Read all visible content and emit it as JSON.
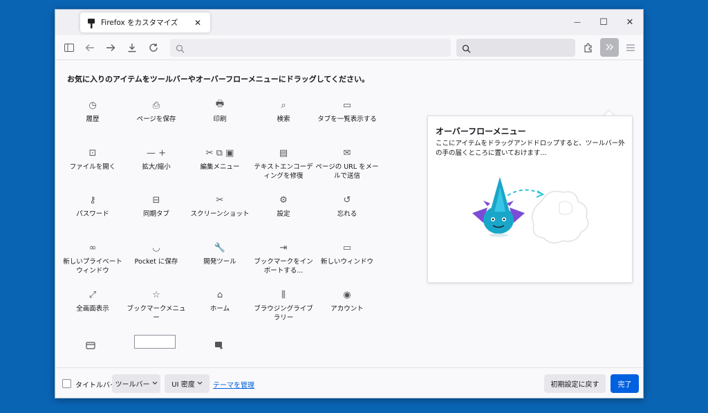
{
  "tab": {
    "title": "Firefox をカスタマイズ",
    "close": "✕"
  },
  "window_controls": {
    "minimize": "—",
    "maximize": "☐",
    "close": "✕"
  },
  "instructions": "お気に入りのアイテムをツールバーやオーバーフローメニューにドラッグしてください。",
  "palette": [
    {
      "label": "履歴",
      "icon": "clock-icon",
      "glyph": "◷"
    },
    {
      "label": "ページを保存",
      "icon": "save-page-icon",
      "glyph": "⎙"
    },
    {
      "label": "印刷",
      "icon": "print-icon",
      "glyph": "🖶"
    },
    {
      "label": "検索",
      "icon": "search-icon",
      "glyph": "⌕"
    },
    {
      "label": "タブを一覧表示する",
      "icon": "tab-list-icon",
      "glyph": "▭"
    },
    {
      "label": "ファイルを開く",
      "icon": "open-file-icon",
      "glyph": "⊡"
    },
    {
      "label": "拡大/縮小",
      "icon": "zoom-icon",
      "glyph": "— +"
    },
    {
      "label": "編集メニュー",
      "icon": "edit-menu-icon",
      "glyph": "✂ ⧉ ▣"
    },
    {
      "label": "テキストエンコーディングを修復",
      "icon": "text-encoding-icon",
      "glyph": "▤"
    },
    {
      "label": "ページの URL をメールで送信",
      "icon": "mail-icon",
      "glyph": "✉"
    },
    {
      "label": "パスワード",
      "icon": "key-icon",
      "glyph": "⚷"
    },
    {
      "label": "同期タブ",
      "icon": "synced-tabs-icon",
      "glyph": "⊟"
    },
    {
      "label": "スクリーンショット",
      "icon": "screenshot-icon",
      "glyph": "✂"
    },
    {
      "label": "設定",
      "icon": "gear-icon",
      "glyph": "⚙"
    },
    {
      "label": "忘れる",
      "icon": "forget-icon",
      "glyph": "↺"
    },
    {
      "label": "新しいプライベートウィンドウ",
      "icon": "private-mask-icon",
      "glyph": "∞"
    },
    {
      "label": "Pocket に保存",
      "icon": "pocket-icon",
      "glyph": "◡"
    },
    {
      "label": "開発ツール",
      "icon": "wrench-icon",
      "glyph": "🔧"
    },
    {
      "label": "ブックマークをインポートする...",
      "icon": "import-icon",
      "glyph": "⇥"
    },
    {
      "label": "新しいウィンドウ",
      "icon": "new-window-icon",
      "glyph": "▭"
    },
    {
      "label": "全画面表示",
      "icon": "fullscreen-icon",
      "glyph": "⤢"
    },
    {
      "label": "ブックマークメニュー",
      "icon": "bookmark-menu-icon",
      "glyph": "☆"
    },
    {
      "label": "ホーム",
      "icon": "home-icon",
      "glyph": "⌂"
    },
    {
      "label": "ブラウジングライブラリー",
      "icon": "library-icon",
      "glyph": "⫼"
    },
    {
      "label": "アカウント",
      "icon": "account-icon",
      "glyph": "◉"
    }
  ],
  "panel": {
    "title": "オーバーフローメニュー",
    "description": "ここにアイテムをドラッグアンドドロップすると、ツールバー外の手の届くところに置いておけます..."
  },
  "bottom": {
    "titlebar_label": "タイトルバー",
    "toolbar_button": "ツールバー",
    "density_button": "UI 密度",
    "manage_themes": "テーマを管理",
    "restore_defaults": "初期設定に戻す",
    "done": "完了"
  }
}
